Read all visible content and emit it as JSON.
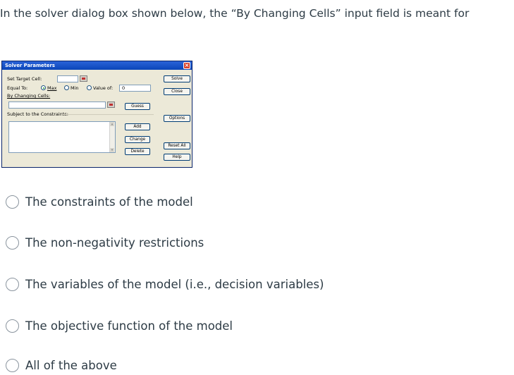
{
  "question": {
    "text": "In the solver dialog box shown below, the “By Changing Cells” input field is meant for"
  },
  "dialog": {
    "title": "Solver Parameters",
    "close_icon": "close-icon",
    "set_target_label": "Set Target Cell:",
    "equal_to_label": "Equal To:",
    "radio_max": "Max",
    "radio_min": "Min",
    "radio_value_of": "Value of:",
    "value_of_input": "0",
    "by_changing_label": "By Changing Cells:",
    "subject_label": "Subject to the Constraints:",
    "buttons": {
      "solve": "Solve",
      "close": "Close",
      "guess": "Guess",
      "options": "Options",
      "add": "Add",
      "change": "Change",
      "delete": "Delete",
      "reset_all": "Reset All",
      "help": "Help"
    },
    "selected_radio": "Max"
  },
  "options": [
    {
      "label": "The constraints of the model"
    },
    {
      "label": "The non-negativity restrictions"
    },
    {
      "label": "The variables of the model (i.e., decision variables)"
    },
    {
      "label": "The objective function of the model"
    },
    {
      "label": "All of the above"
    }
  ],
  "colors": {
    "text": "#2d3b45",
    "dialog_bg": "#ece9d8",
    "titlebar": "#0b45b8",
    "radio_border": "#8a949e"
  }
}
